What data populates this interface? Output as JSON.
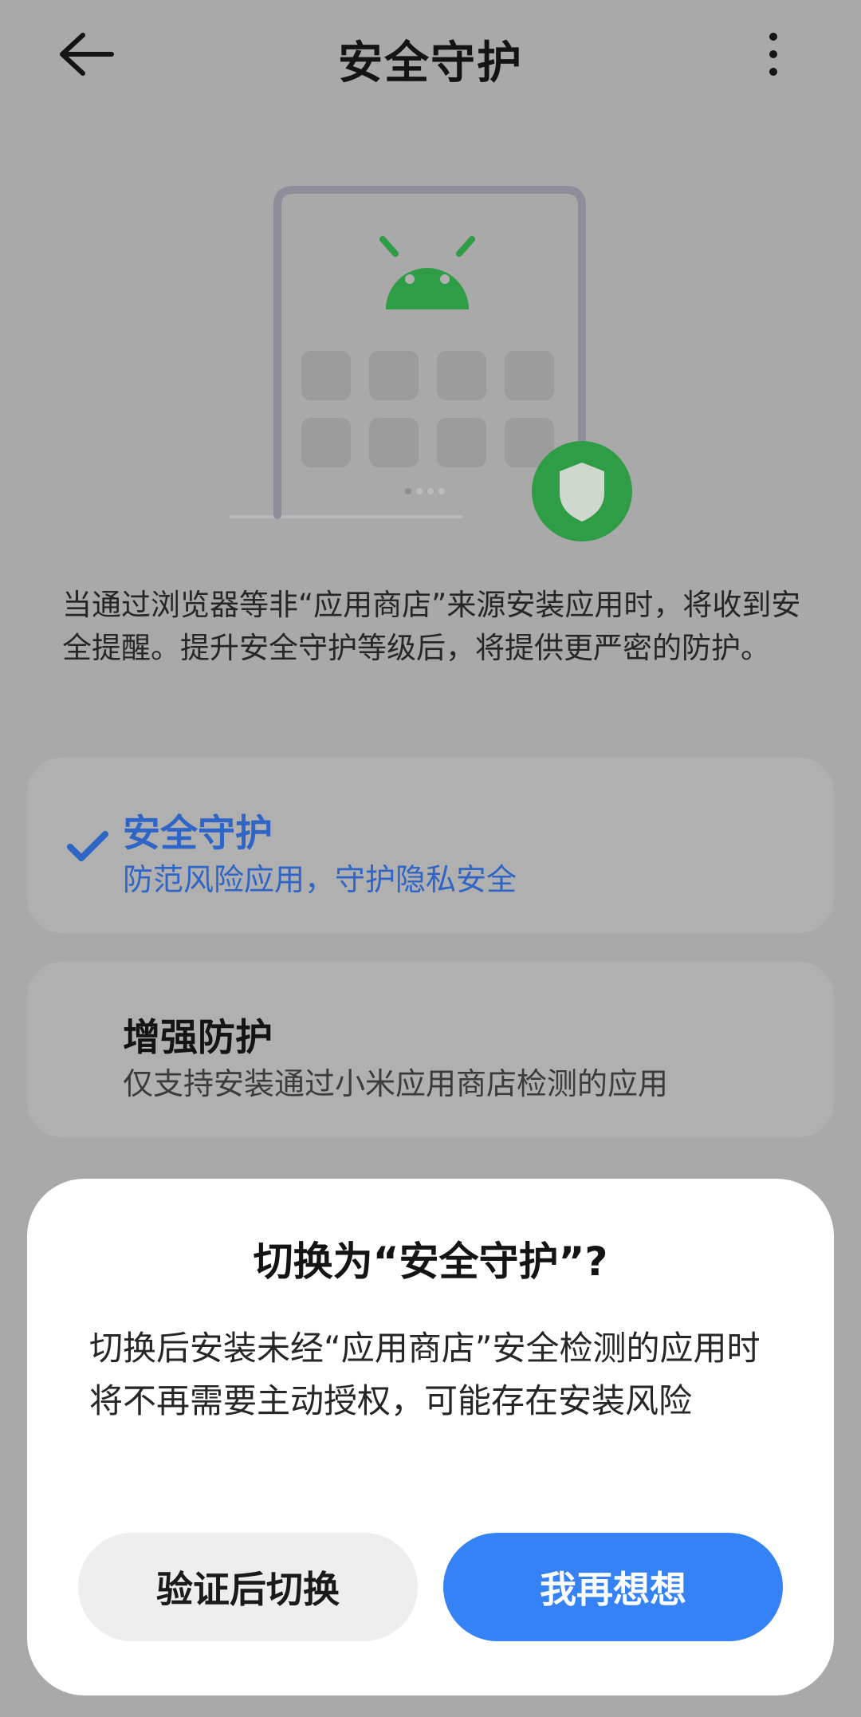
{
  "header": {
    "title": "安全守护",
    "back_icon": "arrow-left-icon",
    "more_icon": "more-vertical-icon"
  },
  "illustration": {
    "robot_icon": "android-robot-icon",
    "shield_icon": "shield-icon",
    "colors": {
      "robot": "#2e9d45",
      "shield_circle": "#2e9d45",
      "phone_frame": "#8e8e9a",
      "tile": "#9c9c9c"
    }
  },
  "description": "当通过浏览器等非“应用商店”来源安装应用时，将收到安全提醒。提升安全守护等级后，将提供更严密的防护。",
  "options": [
    {
      "title": "安全守护",
      "subtitle": "防范风险应用，守护隐私安全",
      "selected": true,
      "icon": "checkmark-icon"
    },
    {
      "title": "增强防护",
      "subtitle": "仅支持安装通过小米应用商店检测的应用",
      "selected": false
    }
  ],
  "dialog": {
    "title": "切换为“安全守护”?",
    "message": "切换后安装未经“应用商店”安全检测的应用时将不再需要主动授权，可能存在安装风险",
    "secondary_button": "验证后切换",
    "primary_button": "我再想想"
  },
  "colors": {
    "accent": "#3482f6",
    "selected_text": "#2f65c6",
    "overlay_background": "#a9a9a9"
  }
}
